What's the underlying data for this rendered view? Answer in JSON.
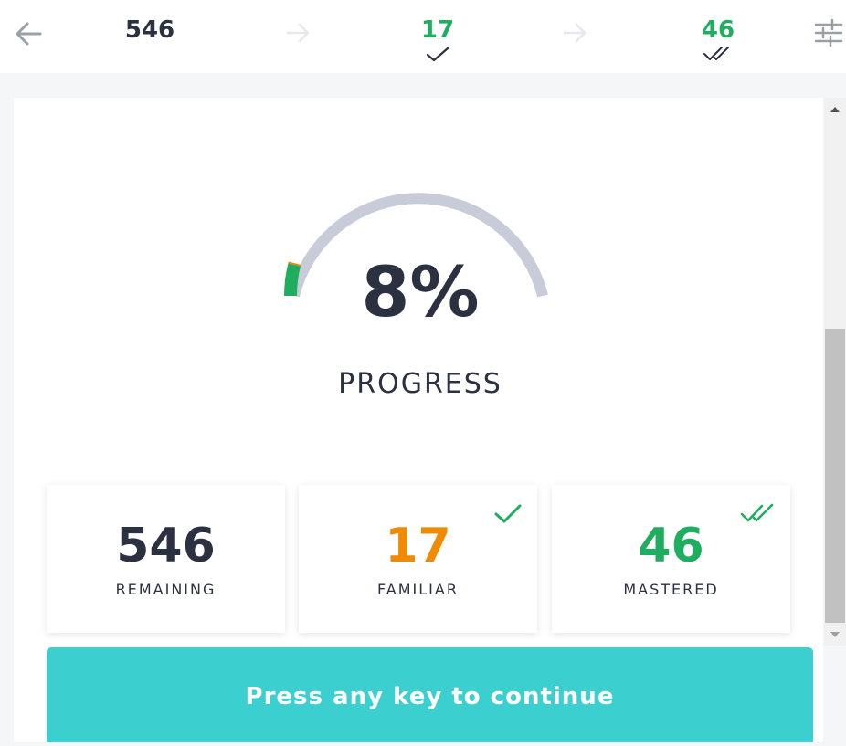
{
  "header": {
    "remaining": "546",
    "familiar": "17",
    "mastered": "46",
    "icons": {
      "back": "arrow-left-icon",
      "arrow": "arrow-right-icon",
      "check": "check-icon",
      "double_check": "double-check-icon",
      "settings": "sliders-icon"
    }
  },
  "progress": {
    "percent_text": "8%",
    "fraction": 0.08,
    "label": "PROGRESS"
  },
  "stats": [
    {
      "value": "546",
      "label": "REMAINING",
      "color": "#2c3142"
    },
    {
      "value": "17",
      "label": "FAMILIAR",
      "color": "#f08a00"
    },
    {
      "value": "46",
      "label": "MASTERED",
      "color": "#1fae60"
    }
  ],
  "continue_label": "Press any key to continue",
  "colors": {
    "accent_teal": "#3ccfcf",
    "green": "#1fae60",
    "orange": "#f08a00",
    "dark_text": "#2c3142",
    "gauge_track": "#c8ccd8"
  }
}
